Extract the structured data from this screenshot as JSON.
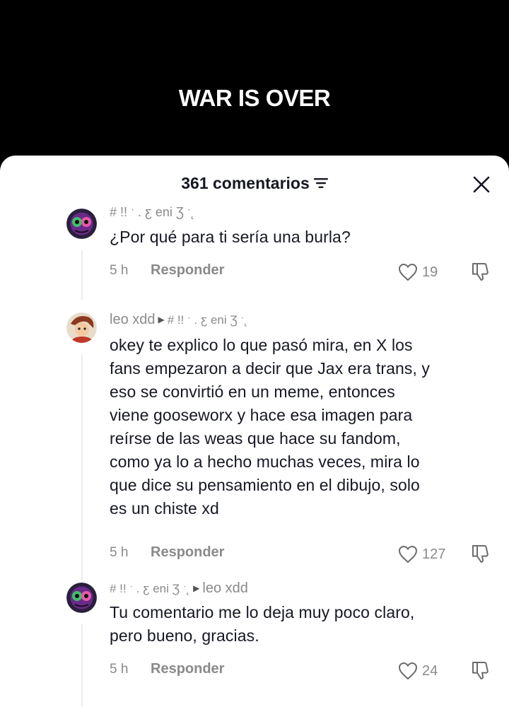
{
  "video": {
    "title": "WAR IS OVER"
  },
  "sheet": {
    "comment_count": "361 comentarios"
  },
  "comments": [
    {
      "author": "# !! ˑ . ƹ eni Ʒ ˑ˛",
      "text": "¿Por qué para ti sería una burla?",
      "time": "5 h",
      "reply_label": "Responder",
      "likes": "19"
    },
    {
      "author": "leo xdd",
      "reply_to": "# !! ˑ . ƹ eni Ʒ ˑ˛",
      "text_lines": [
        "okey te explico lo que pasó mira, en X los",
        "fans empezaron a decir que Jax era trans, y",
        "eso se convirtió en un meme, entonces",
        "viene gooseworx y hace esa imagen para",
        "reírse de las weas que hace su fandom,",
        "como ya lo a hecho muchas veces, mira lo",
        "que dice su pensamiento en el dibujo, solo",
        "es un chiste xd"
      ],
      "time": "5 h",
      "reply_label": "Responder",
      "likes": "127"
    },
    {
      "author": "# !! ˑ . ƹ eni Ʒ ˑ˛",
      "reply_to": "leo xdd",
      "text_lines": [
        "Tu comentario me lo deja muy poco claro,",
        "pero bueno, gracias."
      ],
      "time": "5 h",
      "reply_label": "Responder",
      "likes": "24"
    }
  ],
  "icons": {
    "filter": "filter-icon",
    "close": "close-icon",
    "like": "heart-outline-icon",
    "dislike": "thumbs-down-icon",
    "reply_arrow": "triangle-right-icon"
  },
  "colors": {
    "text_primary": "#161823",
    "text_secondary": "#8a8a8a",
    "sheet_bg": "#ffffff",
    "video_bg": "#000000"
  }
}
